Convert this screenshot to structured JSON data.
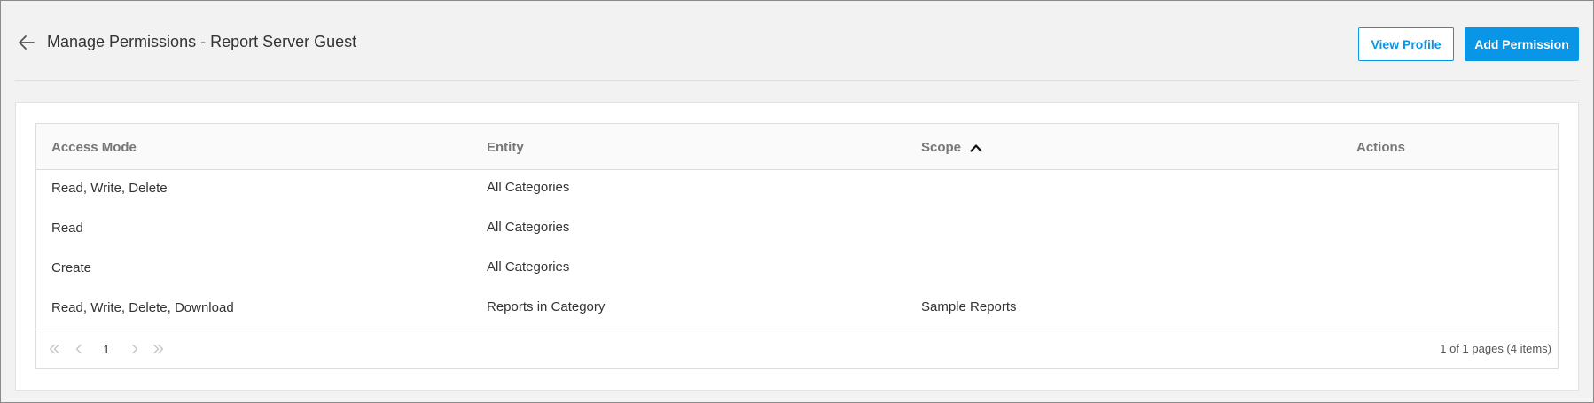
{
  "header": {
    "title": "Manage Permissions - Report Server Guest",
    "buttons": {
      "view_profile": "View Profile",
      "add_permission": "Add Permission"
    }
  },
  "table": {
    "columns": {
      "access_mode": "Access Mode",
      "entity": "Entity",
      "scope": "Scope",
      "actions": "Actions"
    },
    "sort": {
      "column": "Scope",
      "direction": "ascending",
      "icon": "chevron-up-icon"
    },
    "rows": [
      {
        "access_mode": "Read, Write, Delete",
        "entity": "All Categories",
        "scope": "",
        "actions": ""
      },
      {
        "access_mode": "Read",
        "entity": "All Categories",
        "scope": "",
        "actions": ""
      },
      {
        "access_mode": "Create",
        "entity": "All Categories",
        "scope": "",
        "actions": ""
      },
      {
        "access_mode": "Read, Write, Delete, Download",
        "entity": "Reports in Category",
        "scope": "Sample Reports",
        "actions": ""
      }
    ]
  },
  "pager": {
    "current_page": "1",
    "info": "1 of 1 pages (4 items)"
  },
  "colors": {
    "accent": "#0a96e6",
    "page_bg": "#f2f2f2",
    "header_text": "#777777",
    "disabled_icon": "#c4c4c4"
  }
}
